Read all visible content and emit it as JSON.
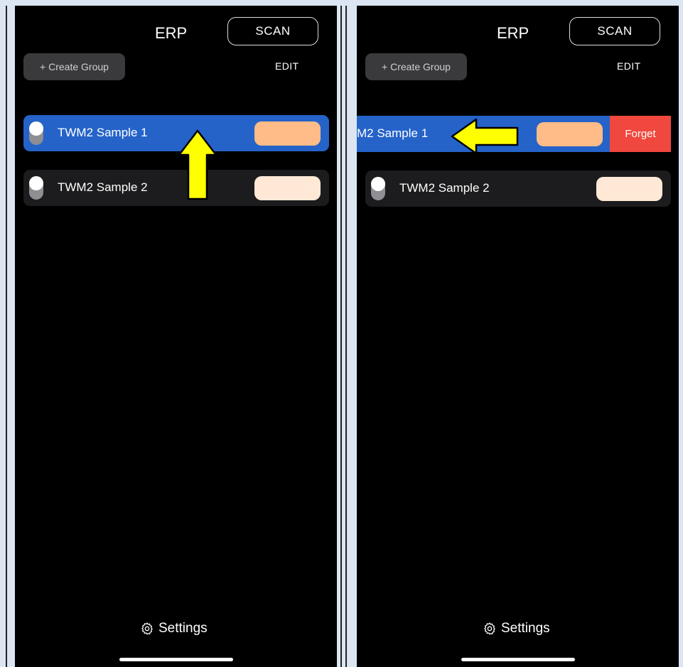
{
  "panels": [
    {
      "logo": "ERP",
      "scan_label": "SCAN",
      "create_group_label": "+ Create Group",
      "edit_label": "EDIT",
      "devices": [
        {
          "name": "TWM2 Sample 1",
          "selected": true,
          "swatch_color": "#ffbb88"
        },
        {
          "name": "TWM2 Sample 2",
          "selected": false,
          "swatch_color": "#ffe9d6"
        }
      ],
      "settings_label": "Settings",
      "annotation_arrow": "up"
    },
    {
      "logo": "ERP",
      "scan_label": "SCAN",
      "create_group_label": "+ Create Group",
      "edit_label": "EDIT",
      "devices": [
        {
          "name": "M2 Sample 1",
          "selected": true,
          "swatch_color": "#ffbb88"
        },
        {
          "name": "TWM2 Sample 2",
          "selected": false,
          "swatch_color": "#ffe9d6"
        }
      ],
      "forget_label": "Forget",
      "settings_label": "Settings",
      "annotation_arrow": "left"
    }
  ],
  "colors": {
    "selected_row": "#2563c9",
    "forget": "#f0483e",
    "annotation_arrow": "#ffff00"
  },
  "icons": [
    "erp-logo",
    "toggle-switch",
    "gear-icon",
    "arrow-up-annotation",
    "arrow-left-annotation"
  ]
}
